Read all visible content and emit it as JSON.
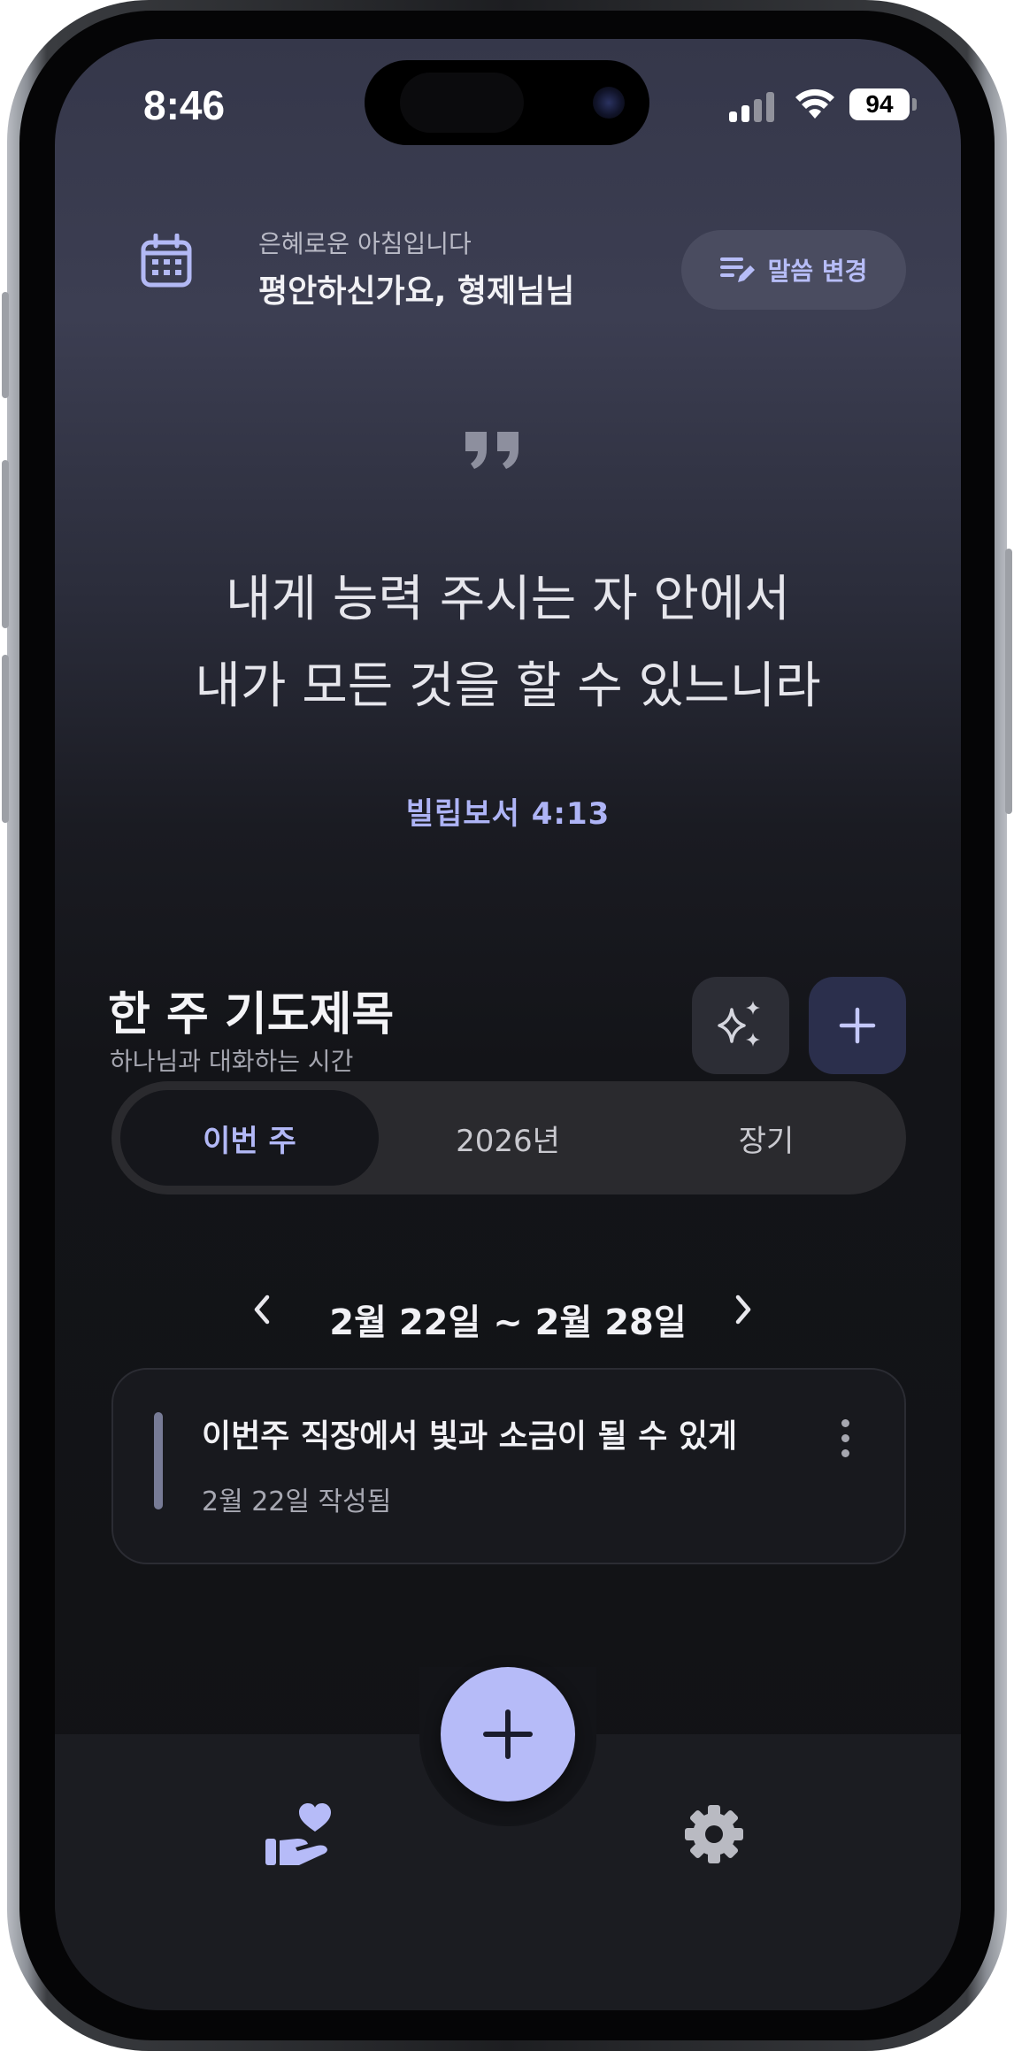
{
  "status_bar": {
    "time": "8:46",
    "battery": "94"
  },
  "header": {
    "greeting_sub": "은혜로운 아침입니다",
    "greeting_main": "평안하신가요, 형제님님",
    "change_verse_label": "말씀 변경"
  },
  "verse": {
    "line1": "내게 능력 주시는 자 안에서",
    "line2": "내가 모든 것을 할 수 있느니라",
    "reference": "빌립보서 4:13"
  },
  "prayer_section": {
    "title": "한 주 기도제목",
    "subtitle": "하나님과 대화하는 시간",
    "tabs": [
      {
        "label": "이번 주",
        "active": true
      },
      {
        "label": "2026년",
        "active": false
      },
      {
        "label": "장기",
        "active": false
      }
    ],
    "week_range": "2월 22일 ~ 2월 28일",
    "items": [
      {
        "title": "이번주 직장에서 빛과 소금이 될 수 있게",
        "date": "2월 22일 작성됨"
      }
    ]
  },
  "nav": {
    "icons": [
      "pray-hand-heart-icon",
      "add-icon",
      "gear-icon"
    ]
  },
  "colors": {
    "accent": "#b6bbf8",
    "accent_text": "#aeb4f6",
    "background": "#131418",
    "card": "#18191e",
    "plus_button": "#2b2f4c"
  }
}
